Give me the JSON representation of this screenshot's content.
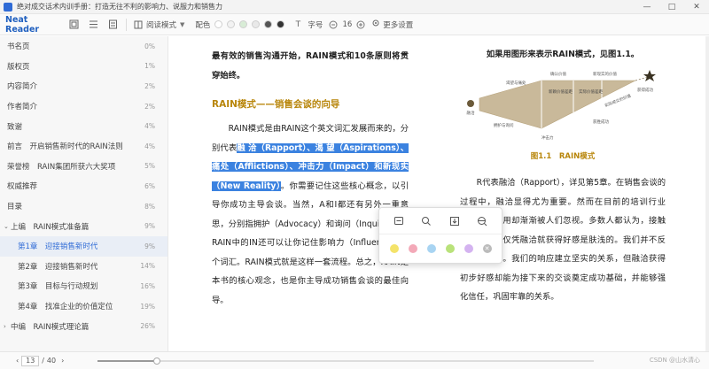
{
  "window": {
    "title": "绝对成交话术内训手册：打造无往不利的影响力、说服力和销售力"
  },
  "toolbar": {
    "brand": "Neat Reader",
    "read_mode": "阅读模式",
    "color_label": "配色",
    "swatches": [
      "#ffffff",
      "#f2f2f2",
      "#d8ecd6",
      "#e9e9e9",
      "#555555",
      "#333333"
    ],
    "font_label": "字号",
    "font_size": "16",
    "more_settings": "更多设置"
  },
  "toc": {
    "items": [
      {
        "label": "书名页",
        "pct": "0%"
      },
      {
        "label": "版权页",
        "pct": "1%"
      },
      {
        "label": "内容简介",
        "pct": "2%"
      },
      {
        "label": "作者简介",
        "pct": "2%"
      },
      {
        "label": "致谢",
        "pct": "4%"
      },
      {
        "label": "前言　开启销售新时代的RAIN法则",
        "pct": "4%"
      },
      {
        "label": "荣誉榜　RAIN集团所获六大奖项",
        "pct": "5%"
      },
      {
        "label": "权威推荐",
        "pct": "6%"
      },
      {
        "label": "目录",
        "pct": "8%"
      },
      {
        "label": "上编　RAIN模式准备篇",
        "pct": "9%"
      },
      {
        "label": "第1章　迎接销售新时代",
        "pct": "9%"
      },
      {
        "label": "第2章　迎接销售新时代",
        "pct": "14%"
      },
      {
        "label": "第3章　目标与行动规划",
        "pct": "16%"
      },
      {
        "label": "第4章　找准企业的价值定位",
        "pct": "19%"
      },
      {
        "label": "中编　RAIN模式理论篇",
        "pct": "26%"
      }
    ]
  },
  "content": {
    "left": {
      "intro": "最有效的销售沟通开始，RAIN模式和10条原则将贯穿始终。",
      "heading": "RAIN模式——销售会谈的向导",
      "p1_a": "RAIN模式是由RAIN这个英文词汇发展而来的，分别代表",
      "p1_hl": "融 洽（Rapport）、渴 望（Aspirations）、痛处（Afflictions）、冲击力（Impact）和新现实（New Reality）",
      "p1_b": "。你需要记住这些核心概念，以引导你成功主导会谈。当然，A和I都还有另外一重意思，分别指拥护（Advocacy）和询问（Inquiry），而RAIN中的IN还可以让你记住影响力（Influence）这个词汇。RAIN模式就是这样一套流程。总之，RAIN是本书的核心观念，也是你主导成功销售会谈的最佳向导。"
    },
    "right": {
      "fig_title": "如果用图形来表示RAIN模式，见图1.1。",
      "fig_labels": {
        "start": "融洽",
        "stage1": "渴望与痛处",
        "stage2": "确认价值",
        "stage3": "新现实的价值",
        "v1": "新颖价值差距",
        "v2": "实际价值差距",
        "under1": "拥护与询问",
        "under2": "冲击力",
        "under3": "获胜成功",
        "end_note": "实际成交的价值",
        "finish": "获得成功"
      },
      "fig_caption": "图1.1　RAIN模式",
      "p2": "R代表融洽（Rapport），详见第5章。在销售会谈的过程中，融洽显得尤为重要。然而在目前的培训行业内，它的作用却渐渐被人们忽视。多数人都认为，接触潜在客户时仅凭融洽就获得好感是肤浅的。我们并不反对这个看法。我们的响应建立坚实的关系，但融洽获得初步好感却能为接下来的交谈奠定成功基础，并能够强化信任，巩固牢靠的关系。"
    }
  },
  "popup": {
    "icons": [
      "note-icon",
      "search-web-icon",
      "copy-icon",
      "translate-icon"
    ],
    "colors": [
      "#f4e36a",
      "#f3a9b8",
      "#a8d4f2",
      "#b9e27a",
      "#d4b3f0"
    ]
  },
  "bottom": {
    "page_current": "13",
    "page_total": "40",
    "progress": 0.12,
    "watermark": "CSDN @山水清心"
  }
}
